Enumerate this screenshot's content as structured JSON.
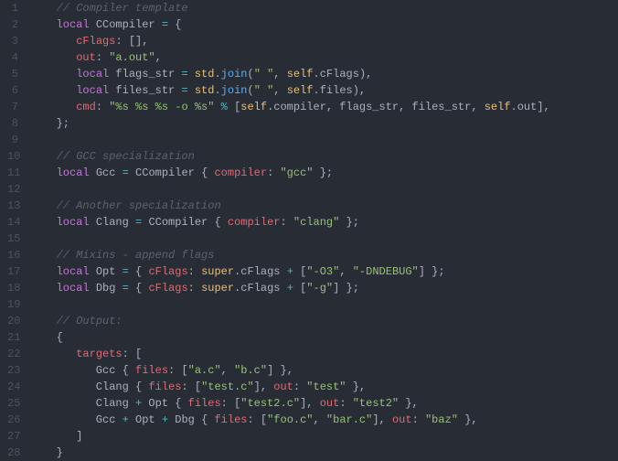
{
  "lines": [
    {
      "n": "1",
      "tokens": [
        {
          "t": "   ",
          "c": ""
        },
        {
          "t": "// Compiler template",
          "c": "c-comment"
        }
      ]
    },
    {
      "n": "2",
      "tokens": [
        {
          "t": "   ",
          "c": ""
        },
        {
          "t": "local",
          "c": "c-keyword"
        },
        {
          "t": " CCompiler ",
          "c": "c-ident"
        },
        {
          "t": "=",
          "c": "c-op"
        },
        {
          "t": " ",
          "c": ""
        },
        {
          "t": "{",
          "c": "c-brace"
        }
      ]
    },
    {
      "n": "3",
      "tokens": [
        {
          "t": "      ",
          "c": ""
        },
        {
          "t": "cFlags",
          "c": "c-prop"
        },
        {
          "t": ": ",
          "c": "c-punct"
        },
        {
          "t": "[]",
          "c": "c-bracket"
        },
        {
          "t": ",",
          "c": "c-punct"
        }
      ]
    },
    {
      "n": "4",
      "tokens": [
        {
          "t": "      ",
          "c": ""
        },
        {
          "t": "out",
          "c": "c-prop"
        },
        {
          "t": ": ",
          "c": "c-punct"
        },
        {
          "t": "\"a.out\"",
          "c": "c-string"
        },
        {
          "t": ",",
          "c": "c-punct"
        }
      ]
    },
    {
      "n": "5",
      "tokens": [
        {
          "t": "      ",
          "c": ""
        },
        {
          "t": "local",
          "c": "c-keyword"
        },
        {
          "t": " flags_str ",
          "c": "c-ident"
        },
        {
          "t": "=",
          "c": "c-op"
        },
        {
          "t": " ",
          "c": ""
        },
        {
          "t": "std",
          "c": "c-builtin"
        },
        {
          "t": ".",
          "c": "c-punct"
        },
        {
          "t": "join",
          "c": "c-func"
        },
        {
          "t": "(",
          "c": "c-punct"
        },
        {
          "t": "\" \"",
          "c": "c-string"
        },
        {
          "t": ", ",
          "c": "c-punct"
        },
        {
          "t": "self",
          "c": "c-self"
        },
        {
          "t": ".cFlags",
          "c": "c-ident"
        },
        {
          "t": "),",
          "c": "c-punct"
        }
      ]
    },
    {
      "n": "6",
      "tokens": [
        {
          "t": "      ",
          "c": ""
        },
        {
          "t": "local",
          "c": "c-keyword"
        },
        {
          "t": " files_str ",
          "c": "c-ident"
        },
        {
          "t": "=",
          "c": "c-op"
        },
        {
          "t": " ",
          "c": ""
        },
        {
          "t": "std",
          "c": "c-builtin"
        },
        {
          "t": ".",
          "c": "c-punct"
        },
        {
          "t": "join",
          "c": "c-func"
        },
        {
          "t": "(",
          "c": "c-punct"
        },
        {
          "t": "\" \"",
          "c": "c-string"
        },
        {
          "t": ", ",
          "c": "c-punct"
        },
        {
          "t": "self",
          "c": "c-self"
        },
        {
          "t": ".files",
          "c": "c-ident"
        },
        {
          "t": "),",
          "c": "c-punct"
        }
      ]
    },
    {
      "n": "7",
      "tokens": [
        {
          "t": "      ",
          "c": ""
        },
        {
          "t": "cmd",
          "c": "c-prop"
        },
        {
          "t": ": ",
          "c": "c-punct"
        },
        {
          "t": "\"%s %s %s -o %s\"",
          "c": "c-string"
        },
        {
          "t": " ",
          "c": ""
        },
        {
          "t": "%",
          "c": "c-op"
        },
        {
          "t": " ",
          "c": ""
        },
        {
          "t": "[",
          "c": "c-bracket"
        },
        {
          "t": "self",
          "c": "c-self"
        },
        {
          "t": ".compiler, flags_str, files_str, ",
          "c": "c-ident"
        },
        {
          "t": "self",
          "c": "c-self"
        },
        {
          "t": ".out",
          "c": "c-ident"
        },
        {
          "t": "]",
          "c": "c-bracket"
        },
        {
          "t": ",",
          "c": "c-punct"
        }
      ]
    },
    {
      "n": "8",
      "tokens": [
        {
          "t": "   ",
          "c": ""
        },
        {
          "t": "};",
          "c": "c-punct"
        }
      ]
    },
    {
      "n": "9",
      "tokens": [
        {
          "t": "",
          "c": ""
        }
      ]
    },
    {
      "n": "10",
      "tokens": [
        {
          "t": "   ",
          "c": ""
        },
        {
          "t": "// GCC specialization",
          "c": "c-comment"
        }
      ]
    },
    {
      "n": "11",
      "tokens": [
        {
          "t": "   ",
          "c": ""
        },
        {
          "t": "local",
          "c": "c-keyword"
        },
        {
          "t": " Gcc ",
          "c": "c-ident"
        },
        {
          "t": "=",
          "c": "c-op"
        },
        {
          "t": " CCompiler ",
          "c": "c-ident"
        },
        {
          "t": "{",
          "c": "c-brace"
        },
        {
          "t": " ",
          "c": ""
        },
        {
          "t": "compiler",
          "c": "c-prop"
        },
        {
          "t": ": ",
          "c": "c-punct"
        },
        {
          "t": "\"gcc\"",
          "c": "c-string"
        },
        {
          "t": " ",
          "c": ""
        },
        {
          "t": "};",
          "c": "c-punct"
        }
      ]
    },
    {
      "n": "12",
      "tokens": [
        {
          "t": "",
          "c": ""
        }
      ]
    },
    {
      "n": "13",
      "tokens": [
        {
          "t": "   ",
          "c": ""
        },
        {
          "t": "// Another specialization",
          "c": "c-comment"
        }
      ]
    },
    {
      "n": "14",
      "tokens": [
        {
          "t": "   ",
          "c": ""
        },
        {
          "t": "local",
          "c": "c-keyword"
        },
        {
          "t": " Clang ",
          "c": "c-ident"
        },
        {
          "t": "=",
          "c": "c-op"
        },
        {
          "t": " CCompiler ",
          "c": "c-ident"
        },
        {
          "t": "{",
          "c": "c-brace"
        },
        {
          "t": " ",
          "c": ""
        },
        {
          "t": "compiler",
          "c": "c-prop"
        },
        {
          "t": ": ",
          "c": "c-punct"
        },
        {
          "t": "\"clang\"",
          "c": "c-string"
        },
        {
          "t": " ",
          "c": ""
        },
        {
          "t": "};",
          "c": "c-punct"
        }
      ]
    },
    {
      "n": "15",
      "tokens": [
        {
          "t": "",
          "c": ""
        }
      ]
    },
    {
      "n": "16",
      "tokens": [
        {
          "t": "   ",
          "c": ""
        },
        {
          "t": "// Mixins - append flags",
          "c": "c-comment"
        }
      ]
    },
    {
      "n": "17",
      "tokens": [
        {
          "t": "   ",
          "c": ""
        },
        {
          "t": "local",
          "c": "c-keyword"
        },
        {
          "t": " Opt ",
          "c": "c-ident"
        },
        {
          "t": "=",
          "c": "c-op"
        },
        {
          "t": " ",
          "c": ""
        },
        {
          "t": "{",
          "c": "c-brace"
        },
        {
          "t": " ",
          "c": ""
        },
        {
          "t": "cFlags",
          "c": "c-prop"
        },
        {
          "t": ": ",
          "c": "c-punct"
        },
        {
          "t": "super",
          "c": "c-self"
        },
        {
          "t": ".cFlags ",
          "c": "c-ident"
        },
        {
          "t": "+",
          "c": "c-op"
        },
        {
          "t": " ",
          "c": ""
        },
        {
          "t": "[",
          "c": "c-bracket"
        },
        {
          "t": "\"-O3\"",
          "c": "c-string"
        },
        {
          "t": ", ",
          "c": "c-punct"
        },
        {
          "t": "\"-DNDEBUG\"",
          "c": "c-string"
        },
        {
          "t": "]",
          "c": "c-bracket"
        },
        {
          "t": " ",
          "c": ""
        },
        {
          "t": "};",
          "c": "c-punct"
        }
      ]
    },
    {
      "n": "18",
      "tokens": [
        {
          "t": "   ",
          "c": ""
        },
        {
          "t": "local",
          "c": "c-keyword"
        },
        {
          "t": " Dbg ",
          "c": "c-ident"
        },
        {
          "t": "=",
          "c": "c-op"
        },
        {
          "t": " ",
          "c": ""
        },
        {
          "t": "{",
          "c": "c-brace"
        },
        {
          "t": " ",
          "c": ""
        },
        {
          "t": "cFlags",
          "c": "c-prop"
        },
        {
          "t": ": ",
          "c": "c-punct"
        },
        {
          "t": "super",
          "c": "c-self"
        },
        {
          "t": ".cFlags ",
          "c": "c-ident"
        },
        {
          "t": "+",
          "c": "c-op"
        },
        {
          "t": " ",
          "c": ""
        },
        {
          "t": "[",
          "c": "c-bracket"
        },
        {
          "t": "\"-g\"",
          "c": "c-string"
        },
        {
          "t": "]",
          "c": "c-bracket"
        },
        {
          "t": " ",
          "c": ""
        },
        {
          "t": "};",
          "c": "c-punct"
        }
      ]
    },
    {
      "n": "19",
      "tokens": [
        {
          "t": "",
          "c": ""
        }
      ]
    },
    {
      "n": "20",
      "tokens": [
        {
          "t": "   ",
          "c": ""
        },
        {
          "t": "// Output:",
          "c": "c-comment"
        }
      ]
    },
    {
      "n": "21",
      "tokens": [
        {
          "t": "   ",
          "c": ""
        },
        {
          "t": "{",
          "c": "c-brace"
        }
      ]
    },
    {
      "n": "22",
      "tokens": [
        {
          "t": "      ",
          "c": ""
        },
        {
          "t": "targets",
          "c": "c-prop"
        },
        {
          "t": ": ",
          "c": "c-punct"
        },
        {
          "t": "[",
          "c": "c-bracket"
        }
      ]
    },
    {
      "n": "23",
      "tokens": [
        {
          "t": "         Gcc ",
          "c": "c-ident"
        },
        {
          "t": "{",
          "c": "c-brace"
        },
        {
          "t": " ",
          "c": ""
        },
        {
          "t": "files",
          "c": "c-prop"
        },
        {
          "t": ": ",
          "c": "c-punct"
        },
        {
          "t": "[",
          "c": "c-bracket"
        },
        {
          "t": "\"a.c\"",
          "c": "c-string"
        },
        {
          "t": ", ",
          "c": "c-punct"
        },
        {
          "t": "\"b.c\"",
          "c": "c-string"
        },
        {
          "t": "]",
          "c": "c-bracket"
        },
        {
          "t": " ",
          "c": ""
        },
        {
          "t": "},",
          "c": "c-punct"
        }
      ]
    },
    {
      "n": "24",
      "tokens": [
        {
          "t": "         Clang ",
          "c": "c-ident"
        },
        {
          "t": "{",
          "c": "c-brace"
        },
        {
          "t": " ",
          "c": ""
        },
        {
          "t": "files",
          "c": "c-prop"
        },
        {
          "t": ": ",
          "c": "c-punct"
        },
        {
          "t": "[",
          "c": "c-bracket"
        },
        {
          "t": "\"test.c\"",
          "c": "c-string"
        },
        {
          "t": "]",
          "c": "c-bracket"
        },
        {
          "t": ", ",
          "c": "c-punct"
        },
        {
          "t": "out",
          "c": "c-prop"
        },
        {
          "t": ": ",
          "c": "c-punct"
        },
        {
          "t": "\"test\"",
          "c": "c-string"
        },
        {
          "t": " ",
          "c": ""
        },
        {
          "t": "},",
          "c": "c-punct"
        }
      ]
    },
    {
      "n": "25",
      "tokens": [
        {
          "t": "         Clang ",
          "c": "c-ident"
        },
        {
          "t": "+",
          "c": "c-op"
        },
        {
          "t": " Opt ",
          "c": "c-ident"
        },
        {
          "t": "{",
          "c": "c-brace"
        },
        {
          "t": " ",
          "c": ""
        },
        {
          "t": "files",
          "c": "c-prop"
        },
        {
          "t": ": ",
          "c": "c-punct"
        },
        {
          "t": "[",
          "c": "c-bracket"
        },
        {
          "t": "\"test2.c\"",
          "c": "c-string"
        },
        {
          "t": "]",
          "c": "c-bracket"
        },
        {
          "t": ", ",
          "c": "c-punct"
        },
        {
          "t": "out",
          "c": "c-prop"
        },
        {
          "t": ": ",
          "c": "c-punct"
        },
        {
          "t": "\"test2\"",
          "c": "c-string"
        },
        {
          "t": " ",
          "c": ""
        },
        {
          "t": "},",
          "c": "c-punct"
        }
      ]
    },
    {
      "n": "26",
      "tokens": [
        {
          "t": "         Gcc ",
          "c": "c-ident"
        },
        {
          "t": "+",
          "c": "c-op"
        },
        {
          "t": " Opt ",
          "c": "c-ident"
        },
        {
          "t": "+",
          "c": "c-op"
        },
        {
          "t": " Dbg ",
          "c": "c-ident"
        },
        {
          "t": "{",
          "c": "c-brace"
        },
        {
          "t": " ",
          "c": ""
        },
        {
          "t": "files",
          "c": "c-prop"
        },
        {
          "t": ": ",
          "c": "c-punct"
        },
        {
          "t": "[",
          "c": "c-bracket"
        },
        {
          "t": "\"foo.c\"",
          "c": "c-string"
        },
        {
          "t": ", ",
          "c": "c-punct"
        },
        {
          "t": "\"bar.c\"",
          "c": "c-string"
        },
        {
          "t": "]",
          "c": "c-bracket"
        },
        {
          "t": ", ",
          "c": "c-punct"
        },
        {
          "t": "out",
          "c": "c-prop"
        },
        {
          "t": ": ",
          "c": "c-punct"
        },
        {
          "t": "\"baz\"",
          "c": "c-string"
        },
        {
          "t": " ",
          "c": ""
        },
        {
          "t": "},",
          "c": "c-punct"
        }
      ]
    },
    {
      "n": "27",
      "tokens": [
        {
          "t": "      ",
          "c": ""
        },
        {
          "t": "]",
          "c": "c-bracket"
        }
      ]
    },
    {
      "n": "28",
      "tokens": [
        {
          "t": "   ",
          "c": ""
        },
        {
          "t": "}",
          "c": "c-brace"
        }
      ]
    }
  ]
}
